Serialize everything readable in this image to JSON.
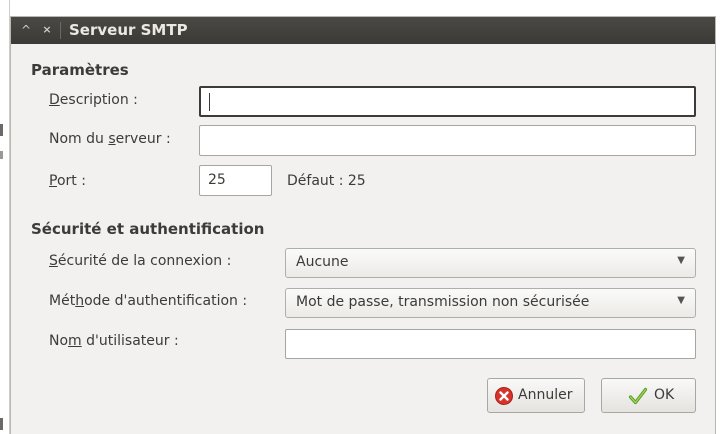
{
  "window": {
    "title": "Serveur SMTP"
  },
  "parametres": {
    "heading": "Paramètres",
    "description": {
      "label_first": "D",
      "label_rest": "escription :",
      "value": ""
    },
    "server_name": {
      "label_pre": "Nom du ",
      "label_u": "s",
      "label_post": "erveur :",
      "value": ""
    },
    "port": {
      "label_first": "P",
      "label_rest": "ort :",
      "value": "25"
    },
    "default_text": "Défaut :  25"
  },
  "securite": {
    "heading": "Sécurité et authentification",
    "connection": {
      "label_first": "S",
      "label_rest": "écurité de la connexion :",
      "selected": "Aucune"
    },
    "auth_method": {
      "label_pre": "Mét",
      "label_u": "h",
      "label_post": "ode d'authentification :",
      "selected": "Mot de passe, transmission non sécurisée"
    },
    "username": {
      "label_pre": "No",
      "label_u": "m",
      "label_post": " d'utilisateur :",
      "value": ""
    }
  },
  "buttons": {
    "cancel_label": "Annuler",
    "ok_label": "OK"
  },
  "icons": {
    "cancel": "cancel-x-icon",
    "ok": "checkmark-icon",
    "dropdown": "triangle-down-icon"
  },
  "colors": {
    "cancel_red": "#d8322b",
    "ok_green": "#7bbf3a",
    "titlebar": "#3c3b37",
    "window_bg": "#f2f1ef"
  }
}
